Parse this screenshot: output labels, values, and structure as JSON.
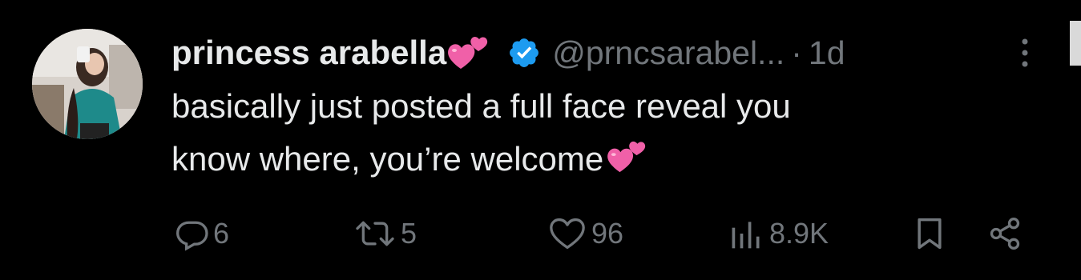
{
  "tweet": {
    "author_name": "princess arabella",
    "name_emoji": "two-hearts",
    "verified": true,
    "handle": "@prncsarabel...",
    "separator": "·",
    "time": "1d",
    "text_line1": "basically just posted a full face reveal you",
    "text_line2": "know where, you’re welcome",
    "text_emoji": "two-hearts"
  },
  "actions": {
    "replies": "6",
    "retweets": "5",
    "likes": "96",
    "views": "8.9K"
  },
  "icons": {
    "reply": "reply-icon",
    "retweet": "retweet-icon",
    "like": "heart-icon",
    "views": "views-icon",
    "bookmark": "bookmark-icon",
    "share": "share-icon",
    "more": "more-options-icon",
    "verified": "verified-badge-icon"
  },
  "colors": {
    "background": "#000000",
    "text": "#e7e9ea",
    "muted": "#71767b",
    "verified": "#1d9bf0",
    "heart_emoji": "#f060a8"
  }
}
